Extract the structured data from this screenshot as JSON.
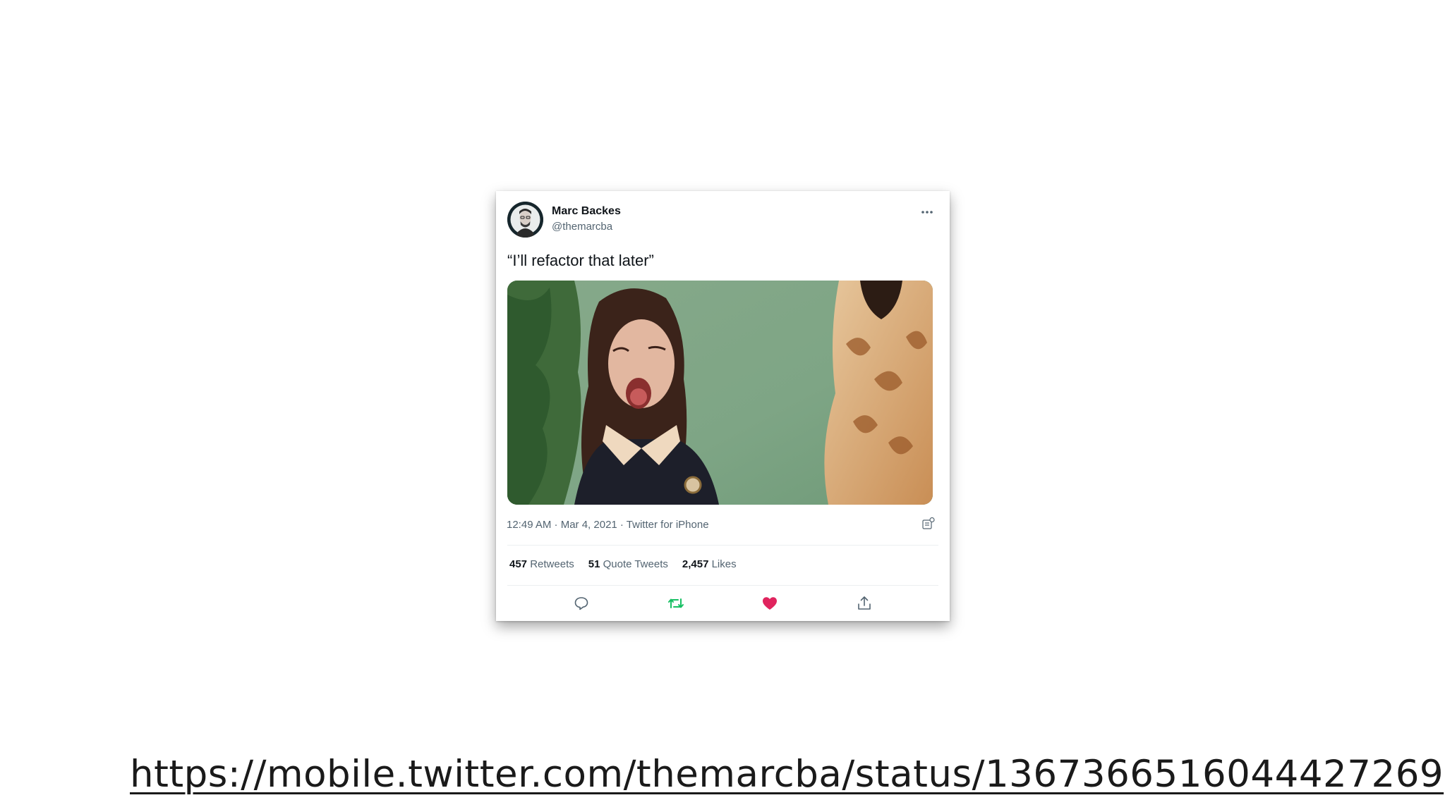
{
  "tweet": {
    "author_name": "Marc Backes",
    "author_handle": "@themarcba",
    "more_icon": "more-horizontal-icon",
    "text": "“I’ll refactor that later”",
    "timestamp": "12:49 AM · Mar 4, 2021 · Twitter for iPhone",
    "stats": {
      "retweets_count": "457",
      "retweets_label": "Retweets",
      "quotes_count": "51",
      "quotes_label": "Quote Tweets",
      "likes_count": "2,457",
      "likes_label": "Likes"
    },
    "actions": [
      "reply-icon",
      "retweet-icon",
      "like-icon",
      "share-icon"
    ],
    "colors": {
      "retweet": "#17bf63",
      "like": "#e0245e",
      "muted": "#536471",
      "text": "#0f1419"
    }
  },
  "footer": {
    "url": "https://mobile.twitter.com/themarcba/status/1367366516044427269"
  }
}
